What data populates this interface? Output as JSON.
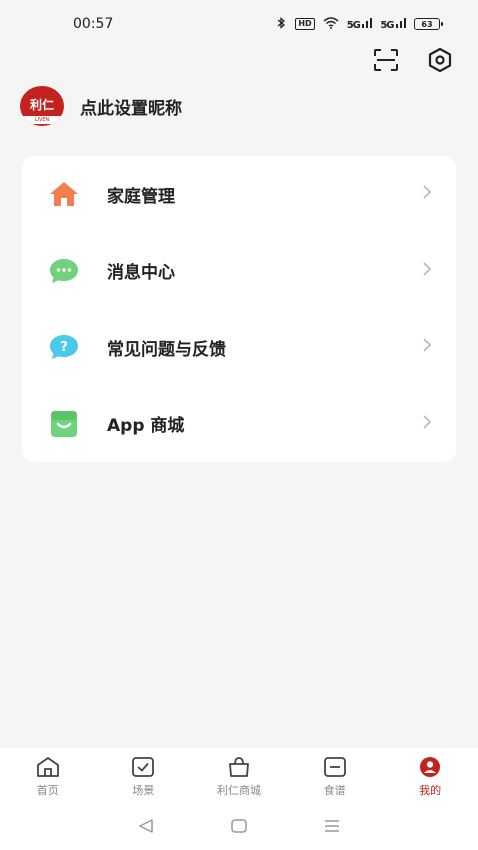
{
  "status_bar": {
    "time": "00:57",
    "hd_label": "HD",
    "signal1": "5G",
    "signal2": "5G",
    "battery": "63"
  },
  "profile": {
    "logo_text": "利仁",
    "logo_sub": "LIVEN",
    "nickname": "点此设置昵称"
  },
  "menu": {
    "items": [
      {
        "label": "家庭管理",
        "icon": "home-icon",
        "color": "#f07f4f"
      },
      {
        "label": "消息中心",
        "icon": "message-icon",
        "color": "#6ed37a"
      },
      {
        "label": "常见问题与反馈",
        "icon": "question-icon",
        "color": "#4ac9e8"
      },
      {
        "label": "App 商城",
        "icon": "shop-icon",
        "color": "#6ed37a"
      }
    ]
  },
  "bottom_nav": {
    "items": [
      {
        "label": "首页",
        "icon": "home-outline-icon"
      },
      {
        "label": "场景",
        "icon": "scene-check-icon"
      },
      {
        "label": "利仁商城",
        "icon": "shopping-bag-icon"
      },
      {
        "label": "食谱",
        "icon": "recipe-icon"
      },
      {
        "label": "我的",
        "icon": "profile-icon",
        "active": true
      }
    ]
  },
  "colors": {
    "accent": "#c4211f",
    "background": "#f5f5f5"
  }
}
